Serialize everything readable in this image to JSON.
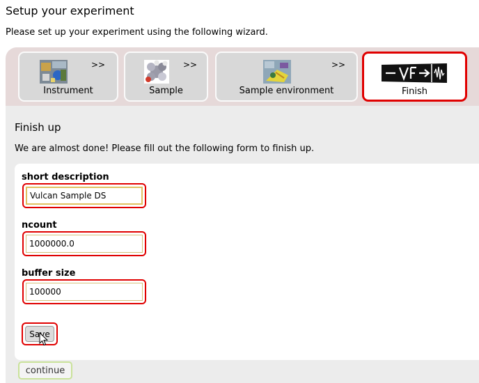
{
  "header": {
    "title": "Setup your experiment",
    "intro": "Please set up your experiment using the following wizard."
  },
  "wizard": {
    "tabs": [
      {
        "label": "Instrument",
        "arrows": ">>",
        "icon": "instrument-thumbnail"
      },
      {
        "label": "Sample",
        "arrows": ">>",
        "icon": "molecule-thumbnail"
      },
      {
        "label": "Sample environment",
        "arrows": ">>",
        "icon": "sample-environment-thumbnail"
      },
      {
        "label": "Finish",
        "icon": "vnf-logo",
        "active": true
      }
    ]
  },
  "finish": {
    "title": "Finish up",
    "text": "We are almost done! Please fill out the following form to finish up."
  },
  "form": {
    "short_description": {
      "label": "short description",
      "value": "Vulcan Sample DS"
    },
    "ncount": {
      "label": "ncount",
      "value": "1000000.0"
    },
    "buffer_size": {
      "label": "buffer size",
      "value": "100000"
    },
    "save_label": "Save"
  },
  "continue_label": "continue",
  "colors": {
    "highlight": "#e00000",
    "wizard_bg": "#e6d9d9",
    "content_bg": "#ececec",
    "continue_border": "#c9e29a"
  }
}
